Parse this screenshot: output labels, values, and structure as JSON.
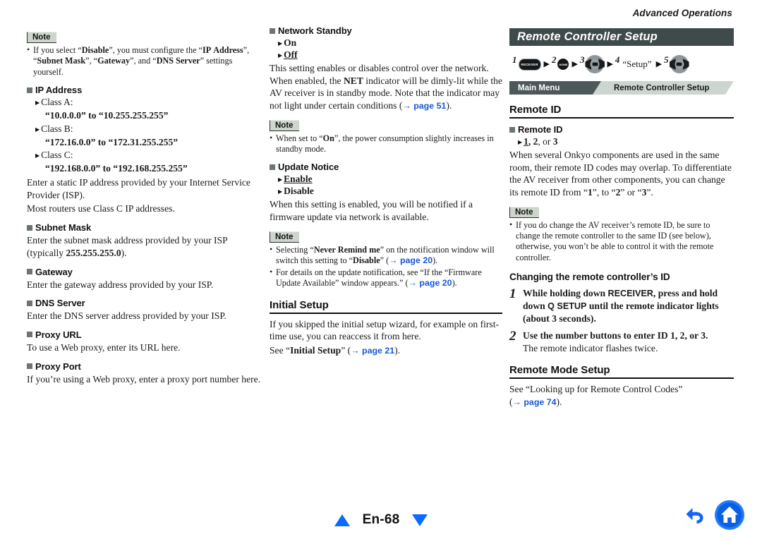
{
  "running_head": "Advanced Operations",
  "footer": {
    "folio": "En-68",
    "prev_icon": "triangle-up-icon",
    "next_icon": "triangle-down-icon",
    "back_icon": "back-arrow-icon",
    "home_icon": "home-icon"
  },
  "column1": {
    "note1": {
      "tag": "Note",
      "items": [
        "If you select “Disable”, you must configure the “IP Address”, “Subnet Mask”, “Gateway”, and “DNS Server” settings yourself."
      ]
    },
    "ip_address": {
      "heading": "IP Address",
      "class_a_label": "Class A:",
      "class_a_range": "“10.0.0.0” to “10.255.255.255”",
      "class_b_label": "Class B:",
      "class_b_range": "“172.16.0.0” to “172.31.255.255”",
      "class_c_label": "Class C:",
      "class_c_range": "“192.168.0.0” to “192.168.255.255”",
      "para1": "Enter a static IP address provided by your Internet Service Provider (ISP).",
      "para2": "Most routers use Class C IP addresses."
    },
    "subnet_mask": {
      "heading": "Subnet Mask",
      "para": "Enter the subnet mask address provided by your ISP (typically 255.255.255.0)."
    },
    "gateway": {
      "heading": "Gateway",
      "para": "Enter the gateway address provided by your ISP."
    },
    "dns_server": {
      "heading": "DNS Server",
      "para": "Enter the DNS server address provided by your ISP."
    },
    "proxy_url": {
      "heading": "Proxy URL",
      "para": "To use a Web proxy, enter its URL here."
    },
    "proxy_port": {
      "heading": "Proxy Port",
      "para": "If you’re using a Web proxy, enter a proxy port number here."
    }
  },
  "column2": {
    "network_standby": {
      "heading": "Network Standby",
      "options": [
        "On",
        "Off"
      ],
      "default_option": "Off",
      "para": "This setting enables or disables control over the network. When enabled, the NET indicator will be dimly-lit while the AV receiver is in standby mode. Note that the indicator may not light under certain conditions (→ page 51).",
      "ref": "page 51",
      "note": {
        "tag": "Note",
        "items": [
          "When set to “On”, the power consumption slightly increases in standby mode."
        ]
      }
    },
    "update_notice": {
      "heading": "Update Notice",
      "options": [
        "Enable",
        "Disable"
      ],
      "default_option": "Enable",
      "para": "When this setting is enabled, you will be notified if a firmware update via network is available.",
      "note": {
        "tag": "Note",
        "item1": "Selecting “Never Remind me” on the notification window will switch this setting to “Disable” (→ page 20).",
        "item1_ref": "page 20",
        "item2": "For details on the update notification, see “If the “Firmware Update Available” window appears.” (→ page 20).",
        "item2_ref": "page 20"
      }
    },
    "initial_setup": {
      "heading": "Initial Setup",
      "para": "If you skipped the initial setup wizard, for example on first-time use, you can reaccess it from here.",
      "see_line": "See “Initial Setup” (→ page 21).",
      "ref": "page 21"
    }
  },
  "column3": {
    "chapter_title": "Remote Controller Setup",
    "path": {
      "steps": [
        {
          "num": "1",
          "icon": "receiver-button-icon",
          "label": "RECEIVER"
        },
        {
          "num": "2",
          "icon": "home-button-icon",
          "label": "HOME"
        },
        {
          "num": "3",
          "icon": "dpad-enter-icon",
          "label": "ENTER"
        },
        {
          "num": "4",
          "icon": "text-label",
          "label": "“Setup”"
        },
        {
          "num": "5",
          "icon": "dpad-enter-icon",
          "label": "ENTER"
        }
      ],
      "arrow": "▶"
    },
    "breadcrumb": {
      "left": "Main Menu",
      "right": "Remote Controller Setup"
    },
    "remote_id_section": {
      "heading": "Remote ID",
      "sub_heading": "Remote ID",
      "options_line": "1, 2, or 3",
      "default_option": "1",
      "para": "When several Onkyo components are used in the same room, their remote ID codes may overlap. To differentiate the AV receiver from other components, you can change its remote ID from “1”, to “2” or “3”.",
      "note": {
        "tag": "Note",
        "items": [
          "If you do change the AV receiver’s remote ID, be sure to change the remote controller to the same ID (see below), otherwise, you won’t be able to control it with the remote controller."
        ]
      },
      "sub_section_title": "Changing the remote controller’s ID",
      "steps": [
        {
          "num": "1",
          "text": "While holding down RECEIVER, press and hold down Q SETUP until the remote indicator lights (about 3 seconds).",
          "sub": ""
        },
        {
          "num": "2",
          "text": "Use the number buttons to enter ID 1, 2, or 3.",
          "sub": "The remote indicator flashes twice."
        }
      ]
    },
    "remote_mode_setup": {
      "heading": "Remote Mode Setup",
      "para": "See “Looking up for Remote Control Codes” (→ page 74).",
      "ref": "page 74"
    }
  }
}
